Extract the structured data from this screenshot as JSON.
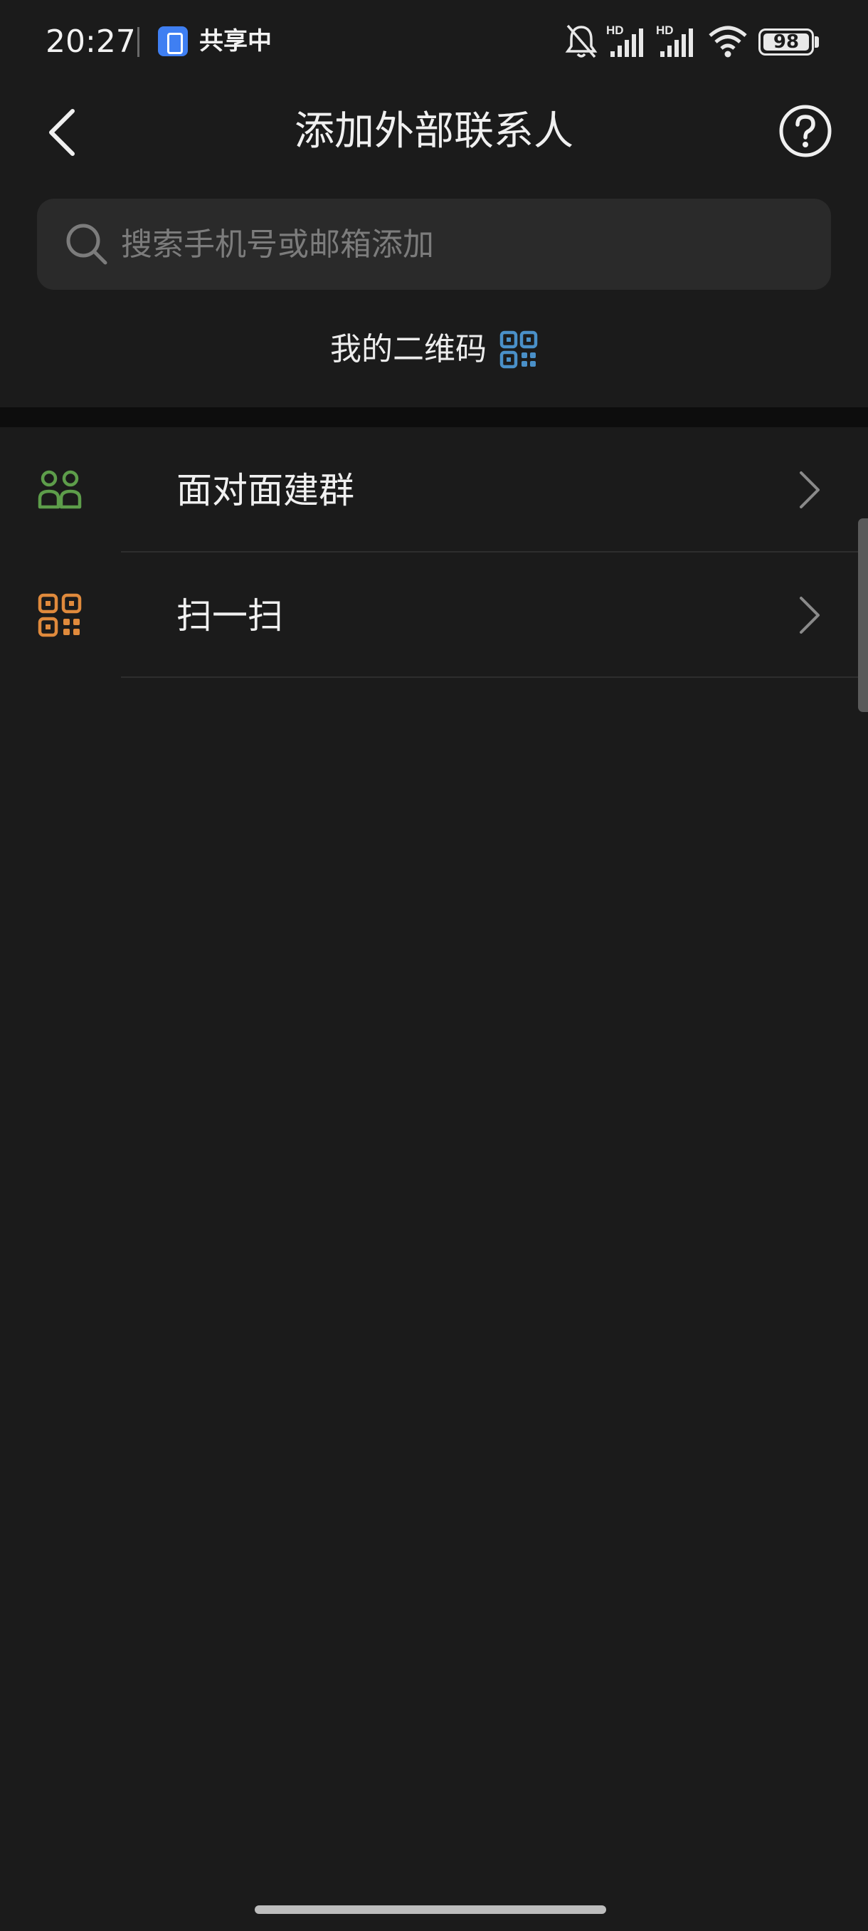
{
  "status_bar": {
    "time": "20:27",
    "sharing_label": "共享中",
    "battery": "98",
    "signal_1_label": "HD",
    "signal_2_label": "HD",
    "icons": [
      "share-screen-icon",
      "mute-bell-icon",
      "signal-hd-icon",
      "signal-hd-icon",
      "wifi-icon",
      "battery-icon"
    ]
  },
  "header": {
    "title": "添加外部联系人",
    "back_icon": "chevron-left-icon",
    "help_icon": "help-circle-icon"
  },
  "search": {
    "placeholder": "搜索手机号或邮箱添加",
    "value": ""
  },
  "my_qr": {
    "label": "我的二维码",
    "icon_color": "#4a90c8"
  },
  "menu": {
    "items": [
      {
        "label": "面对面建群",
        "icon": "face-to-face-group-icon",
        "icon_color": "#5d9d4a"
      },
      {
        "label": "扫一扫",
        "icon": "scan-icon",
        "icon_color": "#e08a3c"
      }
    ]
  },
  "colors": {
    "background": "#1b1b1b",
    "search_background": "#2a2a2a",
    "section_gap": "#0d0d0d"
  }
}
